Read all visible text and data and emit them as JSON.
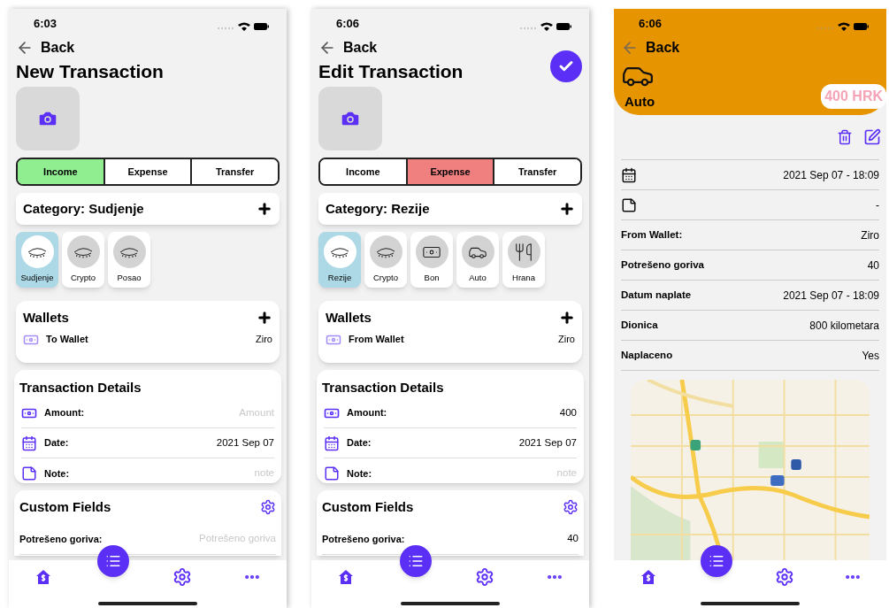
{
  "screens": [
    {
      "kind": "new_form",
      "time": "6:03",
      "back": "Back",
      "title": "New Transaction",
      "types": [
        {
          "label": "Income",
          "selected": true
        },
        {
          "label": "Expense",
          "selected": false
        },
        {
          "label": "Transfer",
          "selected": false
        }
      ],
      "category": "Category: Sudjenje",
      "categories": [
        {
          "label": "Sudjenje",
          "kind": "eye",
          "selected": true
        },
        {
          "label": "Crypto",
          "kind": "eye",
          "selected": false
        },
        {
          "label": "Posao",
          "kind": "eye",
          "selected": false
        }
      ],
      "wallets": {
        "title": "Wallets",
        "label": "To Wallet",
        "value": "Ziro"
      },
      "details": {
        "title": "Transaction Details",
        "rows": [
          {
            "kind": "amount",
            "label": "Amount:",
            "placeholder": "Amount"
          },
          {
            "kind": "date",
            "label": "Date:",
            "value": "2021 Sep 07"
          },
          {
            "kind": "note",
            "label": "Note:",
            "placeholder": "note"
          }
        ]
      },
      "custom": {
        "title": "Custom Fields",
        "rows": [
          {
            "label": "Potrešeno goriva:",
            "placeholder": "Potrešeno goriva"
          }
        ]
      }
    },
    {
      "kind": "edit_form",
      "time": "6:06",
      "back": "Back",
      "title": "Edit Transaction",
      "types": [
        {
          "label": "Income",
          "selected": false
        },
        {
          "label": "Expense",
          "selected": true
        },
        {
          "label": "Transfer",
          "selected": false
        }
      ],
      "category": "Category: Rezije",
      "categories": [
        {
          "label": "Rezije",
          "kind": "eye",
          "selected": true
        },
        {
          "label": "Crypto",
          "kind": "eye",
          "selected": false
        },
        {
          "label": "Bon",
          "kind": "cash",
          "selected": false
        },
        {
          "label": "Auto",
          "kind": "car",
          "selected": false
        },
        {
          "label": "Hrana",
          "kind": "food",
          "selected": false
        }
      ],
      "wallets": {
        "title": "Wallets",
        "label": "From Wallet",
        "value": "Ziro"
      },
      "details": {
        "title": "Transaction Details",
        "rows": [
          {
            "kind": "amount",
            "label": "Amount:",
            "value": "400"
          },
          {
            "kind": "date",
            "label": "Date:",
            "value": "2021 Sep 07"
          },
          {
            "kind": "note",
            "label": "Note:",
            "placeholder": "note"
          }
        ]
      },
      "custom": {
        "title": "Custom Fields",
        "rows": [
          {
            "label": "Potrešeno goriva:",
            "value": "40"
          }
        ]
      }
    },
    {
      "kind": "detail",
      "time": "6:06",
      "back": "Back",
      "category": "Auto",
      "amount": "400 HRK",
      "rows": [
        {
          "kind": "date",
          "value": "2021 Sep 07 - 18:09"
        },
        {
          "kind": "note",
          "value": "-"
        },
        {
          "kind": "field",
          "label": "From Wallet:",
          "value": "Ziro"
        },
        {
          "kind": "field",
          "label": "Potrešeno goriva",
          "value": "40"
        },
        {
          "kind": "field",
          "label": "Datum naplate",
          "value": "2021 Sep 07 - 18:09"
        },
        {
          "kind": "field",
          "label": "Dionica",
          "value": "800 kilometara"
        },
        {
          "kind": "field",
          "label": "Naplaceno",
          "value": "Yes"
        }
      ]
    }
  ]
}
